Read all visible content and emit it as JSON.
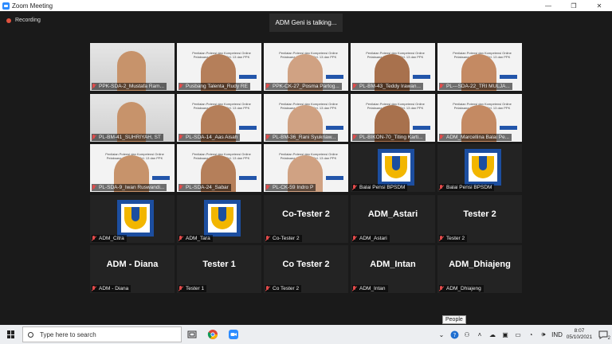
{
  "window": {
    "title": "Zoom Meeting",
    "minimize": "—",
    "maximize": "❐",
    "close": "✕"
  },
  "recording": {
    "label": "Recording"
  },
  "speaker_banner": "ADM Geni is talking...",
  "slide_text": "Penilaian Potensi dan Kompetensi Online Pelaksana S1 Ke Atas Gel. 13 dan PPK Gel. 6",
  "tiles": [
    {
      "name": "PPK-SDA-2_Mustafa Ram...",
      "kind": "camera"
    },
    {
      "name": "Pusbang Talenta_Rudy RE",
      "kind": "slide"
    },
    {
      "name": "PPK-CK-27_Posma Partog...",
      "kind": "slide"
    },
    {
      "name": "PL-BM-43_Teddy Irawan...",
      "kind": "slide"
    },
    {
      "name": "PL---SDA-22_TRI MULJA...",
      "kind": "slide"
    },
    {
      "name": "PL-BM-41_SUHRIYAH, ST",
      "kind": "camera"
    },
    {
      "name": "PL-SDA-14_Aas Aisah",
      "kind": "slide"
    },
    {
      "name": "PL-BM-36_Rani Syukriaw...",
      "kind": "slide"
    },
    {
      "name": "PL-BIKON-70_Titing Karti...",
      "kind": "slide"
    },
    {
      "name": "ADM_Marcellina Balai Pe...",
      "kind": "slide"
    },
    {
      "name": "PL-SDA-9_Iwan Ruswandi...",
      "kind": "slide"
    },
    {
      "name": "PL-SDA-24_Sabar",
      "kind": "slide"
    },
    {
      "name": "PL-CK-59 Indro P",
      "kind": "slide"
    },
    {
      "name": "Balai Pensi BPSDM",
      "kind": "logo"
    },
    {
      "name": "Balai Pensi BPSDM",
      "kind": "logo"
    },
    {
      "name": "ADM_Citra",
      "kind": "logo"
    },
    {
      "name": "ADM_Tara",
      "kind": "logo"
    },
    {
      "name": "Co-Tester 2",
      "kind": "name",
      "big": "Co-Tester 2"
    },
    {
      "name": "ADM_Astari",
      "kind": "name",
      "big": "ADM_Astari"
    },
    {
      "name": "Tester 2",
      "kind": "name",
      "big": "Tester 2"
    },
    {
      "name": "ADM - Diana",
      "kind": "name",
      "big": "ADM - Diana"
    },
    {
      "name": "Tester 1",
      "kind": "name",
      "big": "Tester 1"
    },
    {
      "name": "Co Tester 2",
      "kind": "name",
      "big": "Co Tester 2"
    },
    {
      "name": "ADM_Intan",
      "kind": "name",
      "big": "ADM_Intan"
    },
    {
      "name": "ADM_Dhiajeng",
      "kind": "name",
      "big": "ADM_Dhiajeng"
    }
  ],
  "taskbar": {
    "search_placeholder": "Type here to search",
    "tooltip": "People",
    "language": "IND",
    "time": "8:07",
    "date": "05/10/2021",
    "notification_count": "2"
  }
}
